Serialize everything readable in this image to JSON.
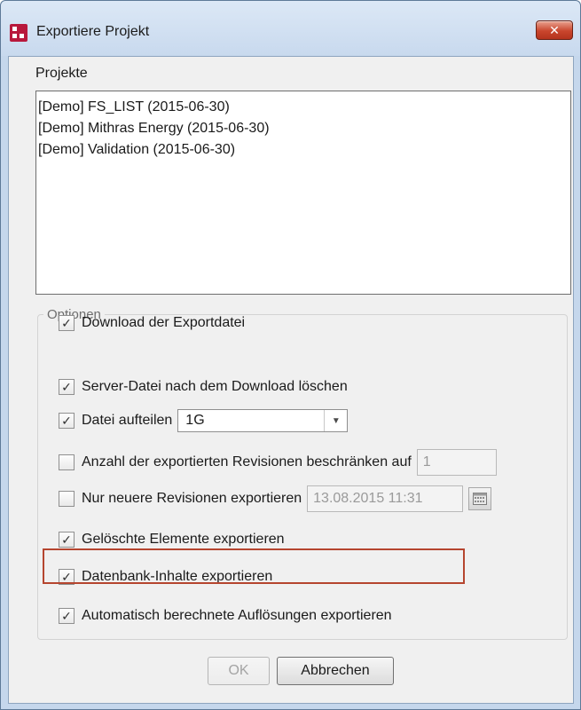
{
  "window": {
    "title": "Exportiere Projekt",
    "close_label": "✕"
  },
  "projects": {
    "label": "Projekte",
    "items": [
      "[Demo] FS_LIST (2015-06-30)",
      "[Demo] Mithras Energy (2015-06-30)",
      "[Demo] Validation (2015-06-30)"
    ]
  },
  "options": {
    "legend": "Optionen",
    "download": {
      "label": "Download der Exportdatei",
      "checked": true
    },
    "delete_server_file": {
      "label": "Server-Datei nach dem Download löschen",
      "checked": true
    },
    "split_file": {
      "label": "Datei aufteilen",
      "checked": true,
      "value": "1G"
    },
    "limit_revisions": {
      "label": "Anzahl der exportierten Revisionen beschränken auf",
      "checked": false,
      "value": "1"
    },
    "newer_revisions": {
      "label": "Nur neuere Revisionen exportieren",
      "checked": false,
      "value": "13.08.2015 11:31"
    },
    "deleted_elements": {
      "label": "Gelöschte Elemente exportieren",
      "checked": true
    },
    "database_content": {
      "label": "Datenbank-Inhalte exportieren",
      "checked": true
    },
    "auto_resolutions": {
      "label": "Automatisch berechnete Auflösungen exportieren",
      "checked": true
    }
  },
  "buttons": {
    "ok": "OK",
    "cancel": "Abbrechen"
  },
  "icons": {
    "check": "✓",
    "dropdown": "▼"
  },
  "colors": {
    "highlight": "#b5452f",
    "close_button": "#c9452d",
    "title_bar": "#c8d9ee"
  }
}
